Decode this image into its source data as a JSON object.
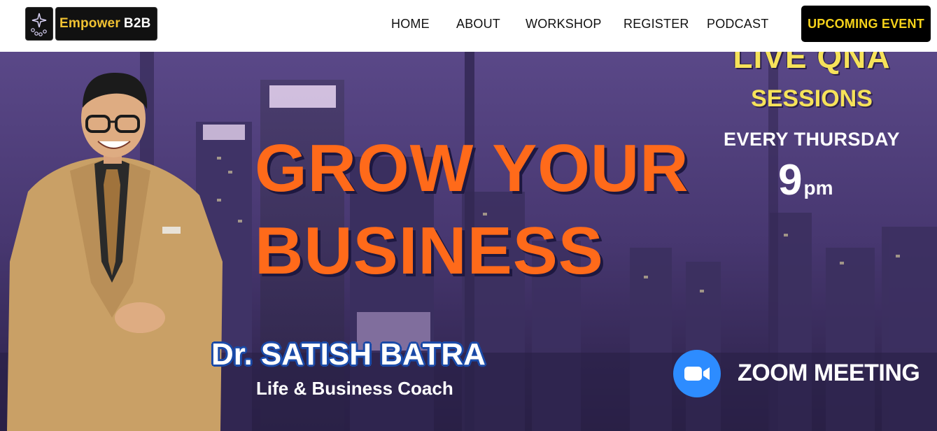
{
  "header": {
    "logo_text": "Empower",
    "logo_suffix": "B2B",
    "nav": [
      "HOME",
      "ABOUT",
      "WORKSHOP",
      "REGISTER",
      "PODCAST"
    ],
    "cta_label": "UPCOMING EVENT"
  },
  "hero": {
    "headline_line1": "GROW YOUR",
    "headline_line2": "BUSINESS",
    "qna_title": "LIVE QNA",
    "qna_sessions": "SESSIONS",
    "qna_day": "EVERY THURSDAY",
    "qna_time_number": "9",
    "qna_time_unit": "pm",
    "coach_name": "Dr. SATISH BATRA",
    "coach_role": "Life & Business Coach",
    "meeting_label": "ZOOM MEETING",
    "meeting_icon": "video-camera-icon"
  },
  "colors": {
    "accent_orange": "#ff6a1a",
    "qna_yellow": "#f6e25a",
    "cta_text": "#f5d21a",
    "zoom_blue": "#2d8cff",
    "name_outline": "#1a4aa8"
  }
}
